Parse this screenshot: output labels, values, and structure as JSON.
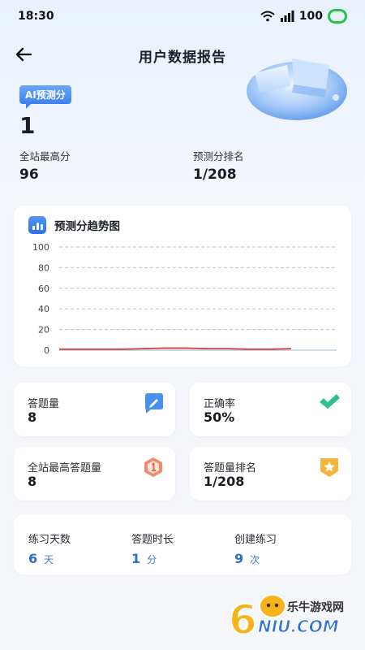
{
  "status": {
    "time": "18:30",
    "battery": "100"
  },
  "header": {
    "title": "用户数据报告"
  },
  "score": {
    "badge": "AI预测分",
    "value": "1"
  },
  "stats": [
    {
      "label": "全站最高分",
      "value": "96"
    },
    {
      "label": "预测分排名",
      "value": "1/208"
    }
  ],
  "chart_data": {
    "type": "line",
    "title": "预测分趋势图",
    "ylim": [
      0,
      100
    ],
    "yticks": [
      0,
      20,
      40,
      60,
      80,
      100
    ],
    "grid": true,
    "series": [
      {
        "values": [
          1,
          1,
          1,
          1,
          1.5,
          2,
          2,
          1.5,
          1.5,
          1,
          1,
          1.5
        ],
        "color": "#d0443b"
      }
    ]
  },
  "cards": [
    {
      "label": "答题量",
      "value": "8",
      "icon": "pencil-badge-icon"
    },
    {
      "label": "正确率",
      "value": "50%",
      "icon": "checkmark-icon"
    },
    {
      "label": "全站最高答题量",
      "value": "8",
      "icon": "medal-one-icon"
    },
    {
      "label": "答题量排名",
      "value": "1/208",
      "icon": "star-badge-icon"
    }
  ],
  "practice": [
    {
      "label": "练习天数",
      "value": "6",
      "unit": "天"
    },
    {
      "label": "答题时长",
      "value": "1",
      "unit": "分"
    },
    {
      "label": "创建练习",
      "value": "9",
      "unit": "次"
    }
  ],
  "watermark": {
    "brand": "乐牛游戏网",
    "domain": "NIU.COM",
    "digit": "6"
  }
}
